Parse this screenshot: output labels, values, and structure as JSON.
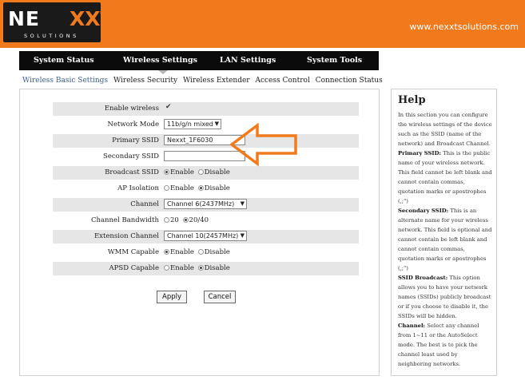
{
  "header": {
    "logo_text": "NE",
    "logo_x": "XXT",
    "logo_sub": "SOLUTIONS",
    "url": "www.nexxtsolutions.com",
    "colors": {
      "brand_orange": "#f07a1c",
      "logo_black": "#1a1a1a"
    }
  },
  "nav": {
    "items": [
      "System Status",
      "Wireless Settings",
      "LAN Settings",
      "System Tools"
    ],
    "active": "Wireless Settings"
  },
  "subtabs": {
    "items": [
      "Wireless Basic Settings",
      "Wireless Security",
      "Wireless Extender",
      "Access Control",
      "Connection Status"
    ],
    "active": "Wireless Basic Settings",
    "active_color": "#3b5f8f"
  },
  "form": {
    "enable_wireless": {
      "label": "Enable wireless",
      "checked": true,
      "mark": "✔"
    },
    "network_mode": {
      "label": "Network Mode",
      "value": "11b/g/n mixed"
    },
    "primary_ssid": {
      "label": "Primary SSID",
      "value": "Nexxt_1F6030"
    },
    "secondary_ssid": {
      "label": "Secondary SSID",
      "value": ""
    },
    "broadcast_ssid": {
      "label": "Broadcast SSID",
      "opt1": "Enable",
      "opt2": "Disable",
      "selected": "Enable"
    },
    "ap_isolation": {
      "label": "AP Isolation",
      "opt1": "Enable",
      "opt2": "Disable",
      "selected": "Disable"
    },
    "channel": {
      "label": "Channel",
      "value": "Channel 6(2437MHz)"
    },
    "channel_bandwidth": {
      "label": "Channel Bandwidth",
      "opt1": "20",
      "opt2": "20/40",
      "selected": "20/40"
    },
    "extension_channel": {
      "label": "Extension Channel",
      "value": "Channel 10(2457MHz)"
    },
    "wmm_capable": {
      "label": "WMM Capable",
      "opt1": "Enable",
      "opt2": "Disable",
      "selected": "Enable"
    },
    "apsd_capable": {
      "label": "APSD Capable",
      "opt1": "Enable",
      "opt2": "Disable",
      "selected": "Disable"
    }
  },
  "buttons": {
    "apply": "Apply",
    "cancel": "Cancel"
  },
  "annotation": {
    "icon": "arrow-left-icon",
    "color": "#f07a1c"
  },
  "help": {
    "title": "Help",
    "intro": "In this section you can configure the wireless settings of the device such as the SSID (name of the network) and Broadcast Channel.",
    "primary_ssid_title": "Primary SSID:",
    "primary_ssid_text": " This is the public name of your wireless network. This field cannot be left blank and cannot contain commas, quotation marks or apostrophes (,;\")",
    "secondary_ssid_title": "Secondary SSID:",
    "secondary_ssid_text": " This is an alternate name for your wireless network. This field is optional and cannot contain be left blank and cannot contain commas, quotation marks or apostrophes (,;\")",
    "ssid_broadcast_title": "SSID Broadcast:",
    "ssid_broadcast_text": " This option allows you to have your network names (SSIDs) publicly broadcast or if you choose to disable it, the SSIDs will be hidden.",
    "channel_title": "Channel:",
    "channel_text": " Select any channel from 1~11 or the AutoSelect mode. The best is to pick the channel least used by neighboring networks."
  }
}
